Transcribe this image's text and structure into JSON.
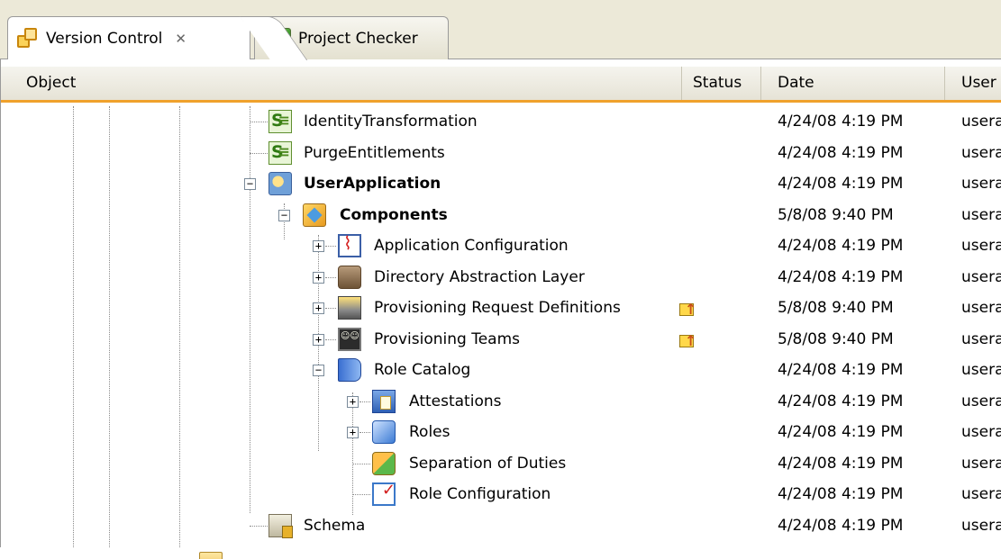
{
  "tabs": [
    {
      "label": "Version Control",
      "close": "✕"
    },
    {
      "label": "Project Checker"
    }
  ],
  "columns": {
    "object": "Object",
    "status": "Status",
    "date": "Date",
    "user": "User"
  },
  "rows": [
    {
      "name": "IdentityTransformation",
      "date": "4/24/08 4:19 PM",
      "user": "usera",
      "icon": "stylesheet-icon"
    },
    {
      "name": "PurgeEntitlements",
      "date": "4/24/08 4:19 PM",
      "user": "usera",
      "icon": "stylesheet-icon"
    },
    {
      "name": "UserApplication",
      "date": "4/24/08 4:19 PM",
      "user": "usera",
      "icon": "user-application-icon"
    },
    {
      "name": "Components",
      "date": "5/8/08 9:40 PM",
      "user": "usera",
      "icon": "components-icon"
    },
    {
      "name": "Application Configuration",
      "date": "4/24/08 4:19 PM",
      "user": "usera",
      "icon": "application-configuration-icon"
    },
    {
      "name": "Directory Abstraction Layer",
      "date": "4/24/08 4:19 PM",
      "user": "usera",
      "icon": "directory-abstraction-layer-icon"
    },
    {
      "name": "Provisioning Request Definitions",
      "date": "5/8/08 9:40 PM",
      "user": "usera",
      "icon": "provisioning-request-icon",
      "status": "outgoing-change-icon"
    },
    {
      "name": "Provisioning Teams",
      "date": "5/8/08 9:40 PM",
      "user": "usera",
      "icon": "provisioning-teams-icon",
      "status": "outgoing-change-icon"
    },
    {
      "name": "Role Catalog",
      "date": "4/24/08 4:19 PM",
      "user": "usera",
      "icon": "role-catalog-icon"
    },
    {
      "name": "Attestations",
      "date": "4/24/08 4:19 PM",
      "user": "usera",
      "icon": "attestations-icon"
    },
    {
      "name": "Roles",
      "date": "4/24/08 4:19 PM",
      "user": "usera",
      "icon": "roles-icon"
    },
    {
      "name": "Separation of Duties",
      "date": "4/24/08 4:19 PM",
      "user": "usera",
      "icon": "separation-of-duties-icon"
    },
    {
      "name": "Role Configuration",
      "date": "4/24/08 4:19 PM",
      "user": "usera",
      "icon": "role-configuration-icon"
    },
    {
      "name": "Schema",
      "date": "4/24/08 4:19 PM",
      "user": "usera",
      "icon": "schema-icon"
    }
  ],
  "icons": {
    "tab_version_control": "version-control-icon",
    "tab_project_checker": "project-checker-icon"
  }
}
